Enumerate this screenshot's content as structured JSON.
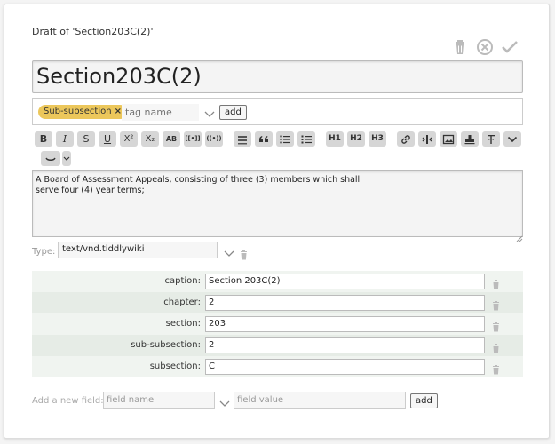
{
  "draft_title": "Draft of 'Section203C(2)'",
  "title": "Section203C(2)",
  "tags": [
    {
      "label": "Sub-subsection"
    }
  ],
  "tag_input": {
    "placeholder": "tag name",
    "add_label": "add"
  },
  "toolbar": {
    "buttons": [
      "bold",
      "italic",
      "strikethrough",
      "underline",
      "superscript",
      "subscript",
      "smallcaps",
      "transclude",
      "macro",
      "monospace",
      "quote",
      "bullet-list",
      "numbered-list",
      "heading-1",
      "heading-2",
      "heading-3",
      "link",
      "linkify",
      "picture",
      "stamp",
      "excise",
      "more",
      "preview",
      "size"
    ],
    "labels": {
      "bold": "B",
      "italic": "I",
      "strike": "S",
      "underline": "U",
      "sup": "X²",
      "sub": "X₂",
      "smallcaps": "AB",
      "transclude": "[[•]]",
      "macro": "((•))",
      "h1": "H1",
      "h2": "H2",
      "h3": "H3"
    }
  },
  "body": "A Board of Assessment Appeals, consisting of three (3) members which shall\nserve four (4) year terms;",
  "type": {
    "label": "Type:",
    "value": "text/vnd.tiddlywiki"
  },
  "fields": [
    {
      "name": "caption:",
      "value": "Section 203C(2)"
    },
    {
      "name": "chapter:",
      "value": "2"
    },
    {
      "name": "section:",
      "value": "203"
    },
    {
      "name": "sub-subsection:",
      "value": "2"
    },
    {
      "name": "subsection:",
      "value": "C"
    }
  ],
  "add_field": {
    "label": "Add a new field:",
    "name_placeholder": "field name",
    "value_placeholder": "field value",
    "add_label": "add"
  },
  "colors": {
    "tag_pill": "#ecc75b",
    "toolbar_button": "#d6d6d6",
    "row_alt": "#e6ece6"
  }
}
